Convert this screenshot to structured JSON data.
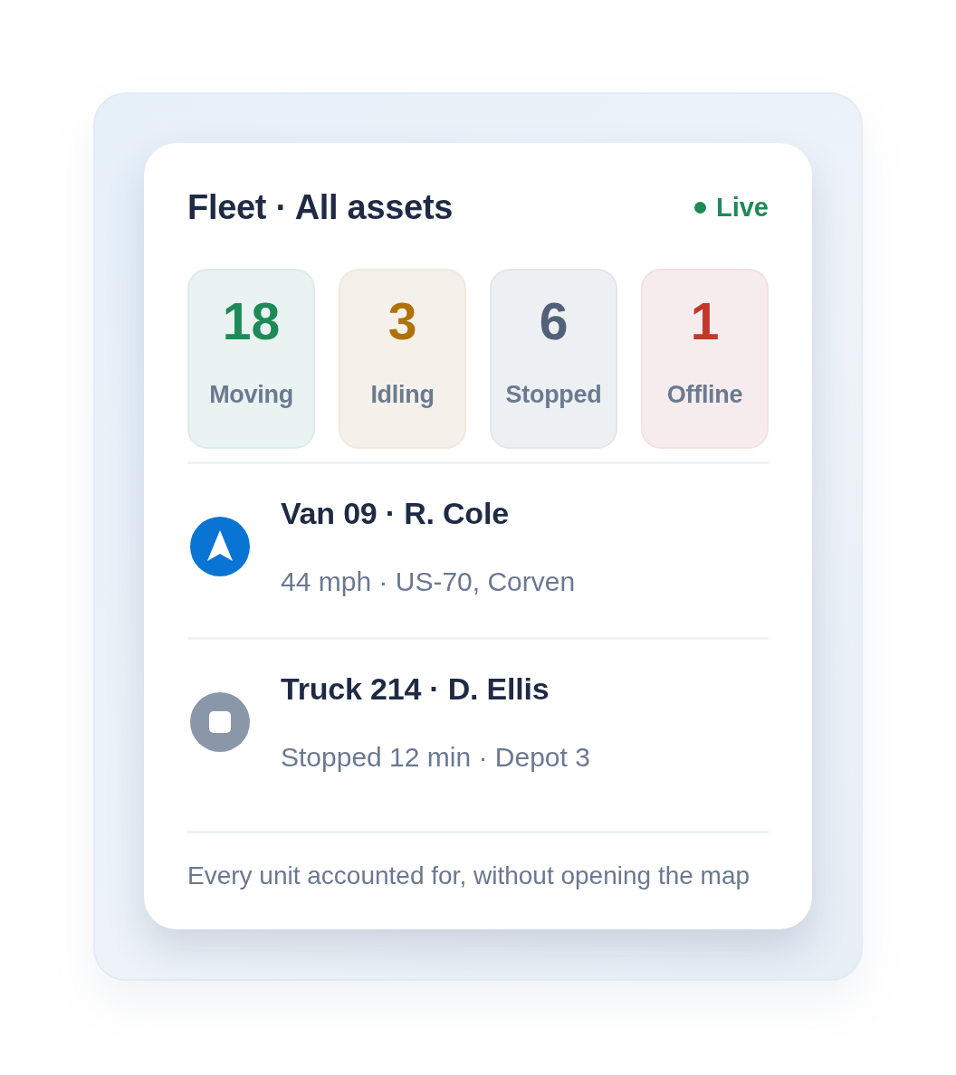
{
  "card": {
    "title": "Fleet · All assets",
    "status": {
      "label": "Live",
      "color": "#1e8a57"
    }
  },
  "tiles": [
    {
      "count": "18",
      "label": "Moving",
      "color": "#1e8a57"
    },
    {
      "count": "3",
      "label": "Idling",
      "color": "#b07208"
    },
    {
      "count": "6",
      "label": "Stopped",
      "color": "#52607a"
    },
    {
      "count": "1",
      "label": "Offline",
      "color": "#c0392b"
    }
  ],
  "vehicles": [
    {
      "kind": "moving",
      "name": "Van 09 · R. Cole",
      "detail": "44 mph · US-70, Corven"
    },
    {
      "kind": "stopped",
      "name": "Truck 214 · D. Ellis",
      "detail": "Stopped 12 min · Depot 3"
    }
  ],
  "footer": "Every unit accounted for, without opening the map"
}
